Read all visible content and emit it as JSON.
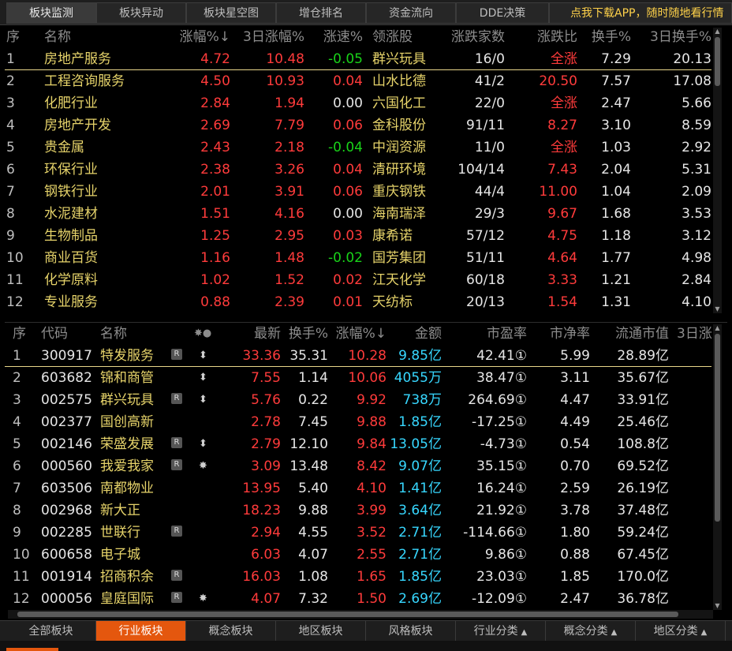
{
  "top_tabs": [
    "板块监测",
    "板块异动",
    "板块星空图",
    "增仓排名",
    "资金流向",
    "DDE决策"
  ],
  "promo_text": "点我下载APP，随时随地看行情",
  "sector_table": {
    "headers": {
      "seq": "序",
      "name": "名称",
      "chg": "涨幅%↓",
      "chg3": "3日涨幅%",
      "speed": "涨速%",
      "leader": "领涨股",
      "updown": "涨跌家数",
      "ratio": "涨跌比",
      "turnover": "换手%",
      "turnover3": "3日换手%"
    },
    "rows": [
      {
        "seq": "1",
        "name": "房地产服务",
        "chg": "4.72",
        "chg3": "10.48",
        "speed": "-0.05",
        "leader": "群兴玩具",
        "updown": "16/0",
        "ratio": "全涨",
        "turnover": "7.29",
        "turnover3": "20.13"
      },
      {
        "seq": "2",
        "name": "工程咨询服务",
        "chg": "4.50",
        "chg3": "10.93",
        "speed": "0.04",
        "leader": "山水比德",
        "updown": "41/2",
        "ratio": "20.50",
        "turnover": "7.57",
        "turnover3": "17.08"
      },
      {
        "seq": "3",
        "name": "化肥行业",
        "chg": "2.84",
        "chg3": "1.94",
        "speed": "0.00",
        "leader": "六国化工",
        "updown": "22/0",
        "ratio": "全涨",
        "turnover": "2.47",
        "turnover3": "5.66"
      },
      {
        "seq": "4",
        "name": "房地产开发",
        "chg": "2.69",
        "chg3": "7.79",
        "speed": "0.06",
        "leader": "金科股份",
        "updown": "91/11",
        "ratio": "8.27",
        "turnover": "3.10",
        "turnover3": "8.59"
      },
      {
        "seq": "5",
        "name": "贵金属",
        "chg": "2.43",
        "chg3": "2.18",
        "speed": "-0.04",
        "leader": "中润资源",
        "updown": "11/0",
        "ratio": "全涨",
        "turnover": "1.03",
        "turnover3": "2.92"
      },
      {
        "seq": "6",
        "name": "环保行业",
        "chg": "2.38",
        "chg3": "3.26",
        "speed": "0.04",
        "leader": "清研环境",
        "updown": "104/14",
        "ratio": "7.43",
        "turnover": "2.04",
        "turnover3": "5.31"
      },
      {
        "seq": "7",
        "name": "钢铁行业",
        "chg": "2.01",
        "chg3": "3.91",
        "speed": "0.06",
        "leader": "重庆钢铁",
        "updown": "44/4",
        "ratio": "11.00",
        "turnover": "1.04",
        "turnover3": "2.09"
      },
      {
        "seq": "8",
        "name": "水泥建材",
        "chg": "1.51",
        "chg3": "4.16",
        "speed": "0.00",
        "leader": "海南瑞泽",
        "updown": "29/3",
        "ratio": "9.67",
        "turnover": "1.68",
        "turnover3": "3.53"
      },
      {
        "seq": "9",
        "name": "生物制品",
        "chg": "1.25",
        "chg3": "2.95",
        "speed": "0.03",
        "leader": "康希诺",
        "updown": "57/12",
        "ratio": "4.75",
        "turnover": "1.18",
        "turnover3": "3.12"
      },
      {
        "seq": "10",
        "name": "商业百货",
        "chg": "1.16",
        "chg3": "1.48",
        "speed": "-0.02",
        "leader": "国芳集团",
        "updown": "51/11",
        "ratio": "4.64",
        "turnover": "1.77",
        "turnover3": "4.98"
      },
      {
        "seq": "11",
        "name": "化学原料",
        "chg": "1.02",
        "chg3": "1.52",
        "speed": "0.02",
        "leader": "江天化学",
        "updown": "60/18",
        "ratio": "3.33",
        "turnover": "1.21",
        "turnover3": "2.84"
      },
      {
        "seq": "12",
        "name": "专业服务",
        "chg": "0.88",
        "chg3": "2.39",
        "speed": "0.01",
        "leader": "天纺标",
        "updown": "20/13",
        "ratio": "1.54",
        "turnover": "1.31",
        "turnover3": "4.10"
      }
    ]
  },
  "stock_table": {
    "headers": {
      "seq": "序",
      "code": "代码",
      "name": "名称",
      "flags": "✸●",
      "price": "最新",
      "turnover": "换手%",
      "chg": "涨幅%↓",
      "amount": "金额",
      "pe": "市盈率",
      "pb": "市净率",
      "float_cap": "流通市值",
      "chg3": "3日涨"
    },
    "rows": [
      {
        "seq": "1",
        "code": "300917",
        "name": "特发服务",
        "r": true,
        "flag": "⬍",
        "price": "33.36",
        "turnover": "35.31",
        "chg": "10.28",
        "amount": "9.85亿",
        "pe": "42.41①",
        "pb": "5.99",
        "float_cap": "28.89亿"
      },
      {
        "seq": "2",
        "code": "603682",
        "name": "锦和商管",
        "r": false,
        "flag": "⬍",
        "price": "7.55",
        "turnover": "1.14",
        "chg": "10.06",
        "amount": "4055万",
        "pe": "38.47①",
        "pb": "3.11",
        "float_cap": "35.67亿"
      },
      {
        "seq": "3",
        "code": "002575",
        "name": "群兴玩具",
        "r": true,
        "flag": "⬍",
        "price": "5.76",
        "turnover": "0.22",
        "chg": "9.92",
        "amount": "738万",
        "pe": "264.69①",
        "pb": "4.47",
        "float_cap": "33.91亿"
      },
      {
        "seq": "4",
        "code": "002377",
        "name": "国创高新",
        "r": false,
        "flag": "",
        "price": "2.78",
        "turnover": "7.45",
        "chg": "9.88",
        "amount": "1.85亿",
        "pe": "-17.25①",
        "pb": "4.49",
        "float_cap": "25.46亿"
      },
      {
        "seq": "5",
        "code": "002146",
        "name": "荣盛发展",
        "r": true,
        "flag": "⬍",
        "price": "2.79",
        "turnover": "12.10",
        "chg": "9.84",
        "amount": "13.05亿",
        "pe": "-4.73①",
        "pb": "0.54",
        "float_cap": "108.8亿"
      },
      {
        "seq": "6",
        "code": "000560",
        "name": "我爱我家",
        "r": true,
        "flag": "✸",
        "price": "3.09",
        "turnover": "13.48",
        "chg": "8.42",
        "amount": "9.07亿",
        "pe": "35.15①",
        "pb": "0.70",
        "float_cap": "69.52亿"
      },
      {
        "seq": "7",
        "code": "603506",
        "name": "南都物业",
        "r": false,
        "flag": "",
        "price": "13.95",
        "turnover": "5.40",
        "chg": "4.10",
        "amount": "1.41亿",
        "pe": "16.24①",
        "pb": "2.59",
        "float_cap": "26.19亿"
      },
      {
        "seq": "8",
        "code": "002968",
        "name": "新大正",
        "r": false,
        "flag": "",
        "price": "18.23",
        "turnover": "9.88",
        "chg": "3.99",
        "amount": "3.64亿",
        "pe": "21.92①",
        "pb": "3.78",
        "float_cap": "37.48亿"
      },
      {
        "seq": "9",
        "code": "002285",
        "name": "世联行",
        "r": true,
        "flag": "",
        "price": "2.94",
        "turnover": "4.55",
        "chg": "3.52",
        "amount": "2.71亿",
        "pe": "-114.66①",
        "pb": "1.80",
        "float_cap": "59.24亿"
      },
      {
        "seq": "10",
        "code": "600658",
        "name": "电子城",
        "r": false,
        "flag": "",
        "price": "6.03",
        "turnover": "4.07",
        "chg": "2.55",
        "amount": "2.71亿",
        "pe": "9.86①",
        "pb": "0.88",
        "float_cap": "67.45亿"
      },
      {
        "seq": "11",
        "code": "001914",
        "name": "招商积余",
        "r": true,
        "flag": "",
        "price": "16.03",
        "turnover": "1.08",
        "chg": "1.65",
        "amount": "1.85亿",
        "pe": "23.03①",
        "pb": "1.85",
        "float_cap": "170.0亿"
      },
      {
        "seq": "12",
        "code": "000056",
        "name": "皇庭国际",
        "r": true,
        "flag": "✸",
        "price": "4.07",
        "turnover": "7.32",
        "chg": "1.50",
        "amount": "2.69亿",
        "pe": "-12.09①",
        "pb": "2.47",
        "float_cap": "36.78亿"
      }
    ]
  },
  "bottom_tabs": [
    {
      "label": "全部板块",
      "caret": false
    },
    {
      "label": "行业板块",
      "caret": false
    },
    {
      "label": "概念板块",
      "caret": false
    },
    {
      "label": "地区板块",
      "caret": false
    },
    {
      "label": "风格板块",
      "caret": false
    },
    {
      "label": "行业分类",
      "caret": true
    },
    {
      "label": "概念分类",
      "caret": true
    },
    {
      "label": "地区分类",
      "caret": true
    }
  ],
  "r_badge": "R",
  "colors": {
    "up": "#ff3b3b",
    "down": "#19d219",
    "accent": "#e4570e",
    "amount": "#37d7ff",
    "name": "#e6d36a"
  }
}
